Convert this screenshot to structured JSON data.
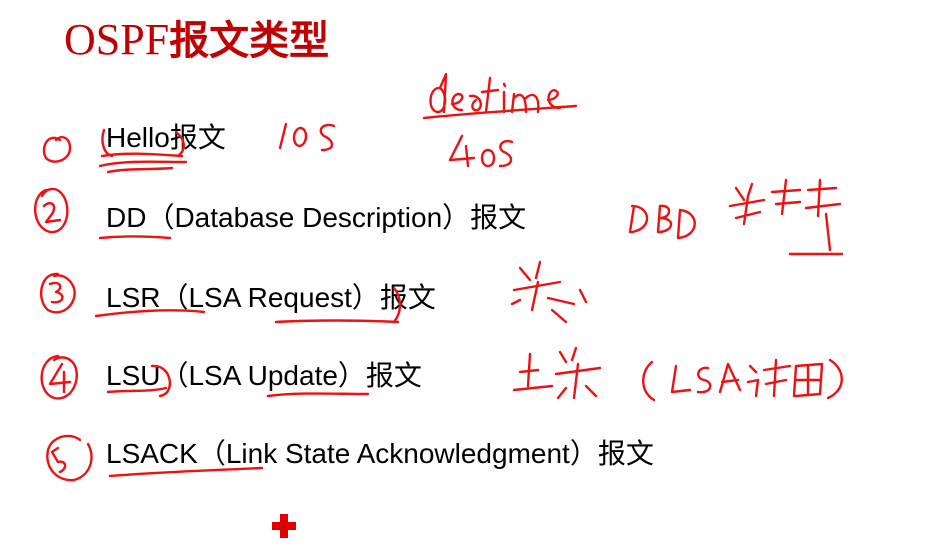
{
  "slide": {
    "title_latin": "OSPF",
    "title_cn": "报文类型",
    "items": [
      {
        "code": "Hello",
        "detail": "",
        "suffix": "报文"
      },
      {
        "code": "DD",
        "detail": "（Database Description）",
        "suffix": "报文"
      },
      {
        "code": "LSR",
        "detail": "（LSA Request）",
        "suffix": "报文"
      },
      {
        "code": "LSU",
        "detail": "（LSA Update）",
        "suffix": "报文"
      },
      {
        "code": "LSACK",
        "detail": "（Link State Acknowledgment）",
        "suffix": "报文"
      }
    ],
    "annotation_color": "#ee1111",
    "marker": "red-cross"
  }
}
